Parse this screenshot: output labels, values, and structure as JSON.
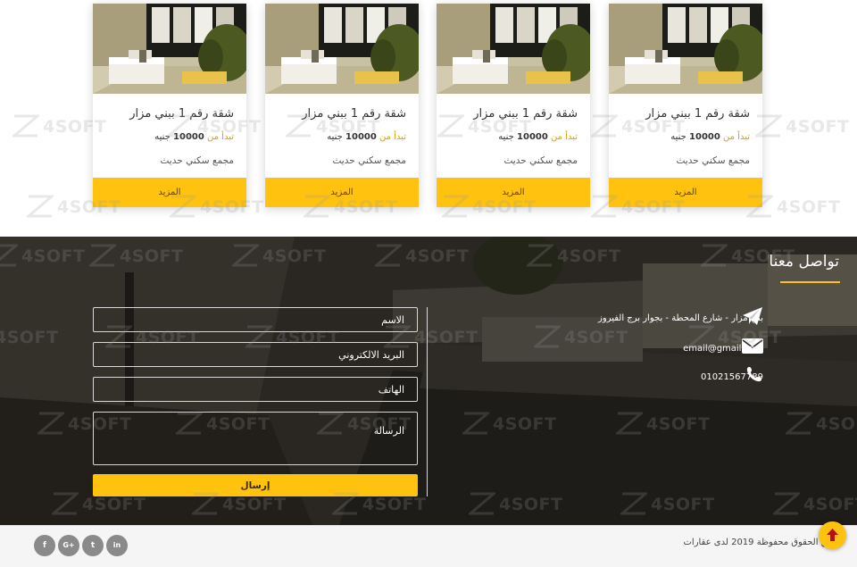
{
  "listings": [
    {
      "title": "شقة رقم 1 ببني مزار",
      "price_prefix": "تبدأ من",
      "price_value": "10000",
      "price_unit": "جنيه",
      "description": "مجمع سكني حديث",
      "more_label": "المزيد"
    },
    {
      "title": "شقة رقم 1 ببني مزار",
      "price_prefix": "تبدأ من",
      "price_value": "10000",
      "price_unit": "جنيه",
      "description": "مجمع سكني حديث",
      "more_label": "المزيد"
    },
    {
      "title": "شقة رقم 1 ببني مزار",
      "price_prefix": "تبدأ من",
      "price_value": "10000",
      "price_unit": "جنيه",
      "description": "مجمع سكني حديث",
      "more_label": "المزيد"
    },
    {
      "title": "شقة رقم 1 ببني مزار",
      "price_prefix": "تبدأ من",
      "price_value": "10000",
      "price_unit": "جنيه",
      "description": "مجمع سكني حديث",
      "more_label": "المزيد"
    }
  ],
  "contact": {
    "title": "تواصل معنا",
    "address": "بني مزار - شارع المحطة - بجوار برج الفيروز",
    "address_icon": "paper-plane-icon",
    "email": "email@gmail.com",
    "email_icon": "envelope-icon",
    "phone": "01021567789",
    "phone_icon": "phone-icon",
    "form": {
      "name_placeholder": "الاسم",
      "email_placeholder": "البريد الالكتروني",
      "phone_placeholder": "الهاتف",
      "message_placeholder": "الرسالة",
      "submit_label": "إرسال"
    }
  },
  "footer": {
    "copyright": "جميع الحقوق محفوظة 2019 لدى عقارات",
    "social": [
      {
        "icon": "linkedin-icon",
        "glyph": "in"
      },
      {
        "icon": "twitter-icon",
        "glyph": "t"
      },
      {
        "icon": "google-plus-icon",
        "glyph": "G+"
      },
      {
        "icon": "facebook-icon",
        "glyph": "f"
      }
    ]
  },
  "watermark": "4SOFT",
  "colors": {
    "accent": "#fec20f",
    "footer_bg": "#f5f5f5",
    "dark_bg": "#1c1a17"
  }
}
